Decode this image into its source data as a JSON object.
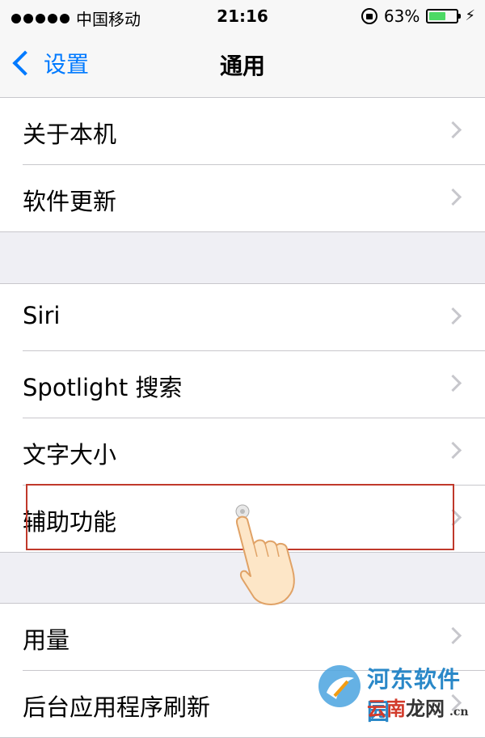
{
  "status_bar": {
    "carrier": "中国移动",
    "time": "21:16",
    "battery_percent_label": "63%",
    "battery_level": 0.63,
    "icons": [
      "signal-dots-icon",
      "orientation-lock-icon",
      "battery-icon",
      "charging-icon"
    ],
    "charging_symbol": "⚡"
  },
  "navbar": {
    "back_label": "设置",
    "title": "通用"
  },
  "groups": [
    {
      "rows": [
        {
          "label": "关于本机"
        },
        {
          "label": "软件更新"
        }
      ]
    },
    {
      "rows": [
        {
          "label": "Siri"
        },
        {
          "label": "Spotlight 搜索"
        },
        {
          "label": "文字大小"
        },
        {
          "label": "辅助功能"
        }
      ]
    },
    {
      "rows": [
        {
          "label": "用量"
        },
        {
          "label": "后台应用程序刷新"
        }
      ]
    }
  ],
  "annotation": {
    "highlighted_item": "辅助功能",
    "highlight_color": "#c0392b"
  },
  "watermark": {
    "line1": "河东软件园",
    "line2_prefix": "云南",
    "line2_mid": "龙网",
    "line2_suffix": ".cn"
  },
  "colors": {
    "accent": "#007aff",
    "background": "#efeff4",
    "chevron": "#c7c7cc",
    "battery_fill": "#4cd964"
  }
}
